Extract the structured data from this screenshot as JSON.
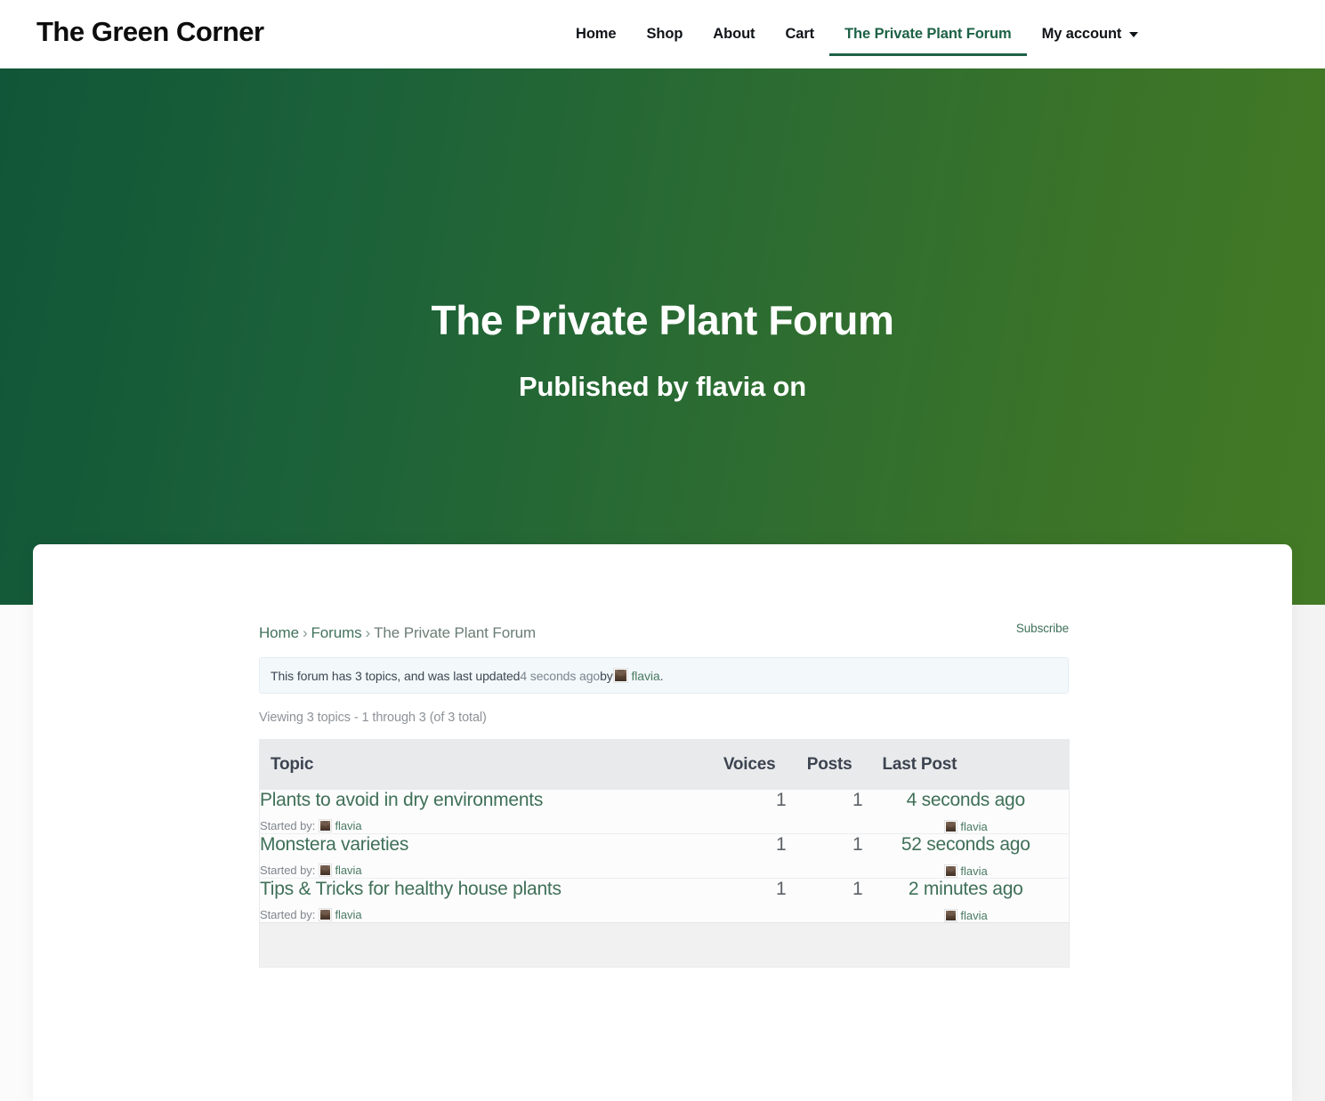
{
  "header": {
    "brand": "The Green Corner",
    "nav": [
      {
        "label": "Home",
        "active": false
      },
      {
        "label": "Shop",
        "active": false
      },
      {
        "label": "About",
        "active": false
      },
      {
        "label": "Cart",
        "active": false
      },
      {
        "label": "The Private Plant Forum",
        "active": true
      },
      {
        "label": "My account",
        "active": false,
        "caret": true
      }
    ],
    "accent_color": "#1d6246"
  },
  "hero": {
    "title": "The Private Plant Forum",
    "published_prefix": "Published by ",
    "author": "flavia",
    "published_suffix": " on",
    "gradient_from": "#115638",
    "gradient_to": "#437a25"
  },
  "breadcrumb": {
    "home": "Home",
    "sep1": "›",
    "forums": "Forums",
    "sep2": "›",
    "current": "The Private Plant Forum"
  },
  "subscribe": {
    "label": "Subscribe"
  },
  "notice": {
    "prefix": "This forum has 3 topics, and was last updated ",
    "time": "4 seconds ago",
    "by": " by ",
    "user": "flavia",
    "period": "."
  },
  "viewing": {
    "text": "Viewing 3 topics - 1 through 3 (of 3 total)"
  },
  "table": {
    "columns": {
      "topic": "Topic",
      "voices": "Voices",
      "posts": "Posts",
      "last_post": "Last Post"
    },
    "started_by_label": "Started by:",
    "rows": [
      {
        "title": "Plants to avoid in dry environments",
        "started_by": "flavia",
        "voices": "1",
        "posts": "1",
        "last_post_time": "4 seconds ago",
        "last_post_author": "flavia"
      },
      {
        "title": "Monstera varieties",
        "started_by": "flavia",
        "voices": "1",
        "posts": "1",
        "last_post_time": "52 seconds ago",
        "last_post_author": "flavia"
      },
      {
        "title": "Tips & Tricks for healthy house plants",
        "started_by": "flavia",
        "voices": "1",
        "posts": "1",
        "last_post_time": "2 minutes ago",
        "last_post_author": "flavia"
      }
    ]
  }
}
